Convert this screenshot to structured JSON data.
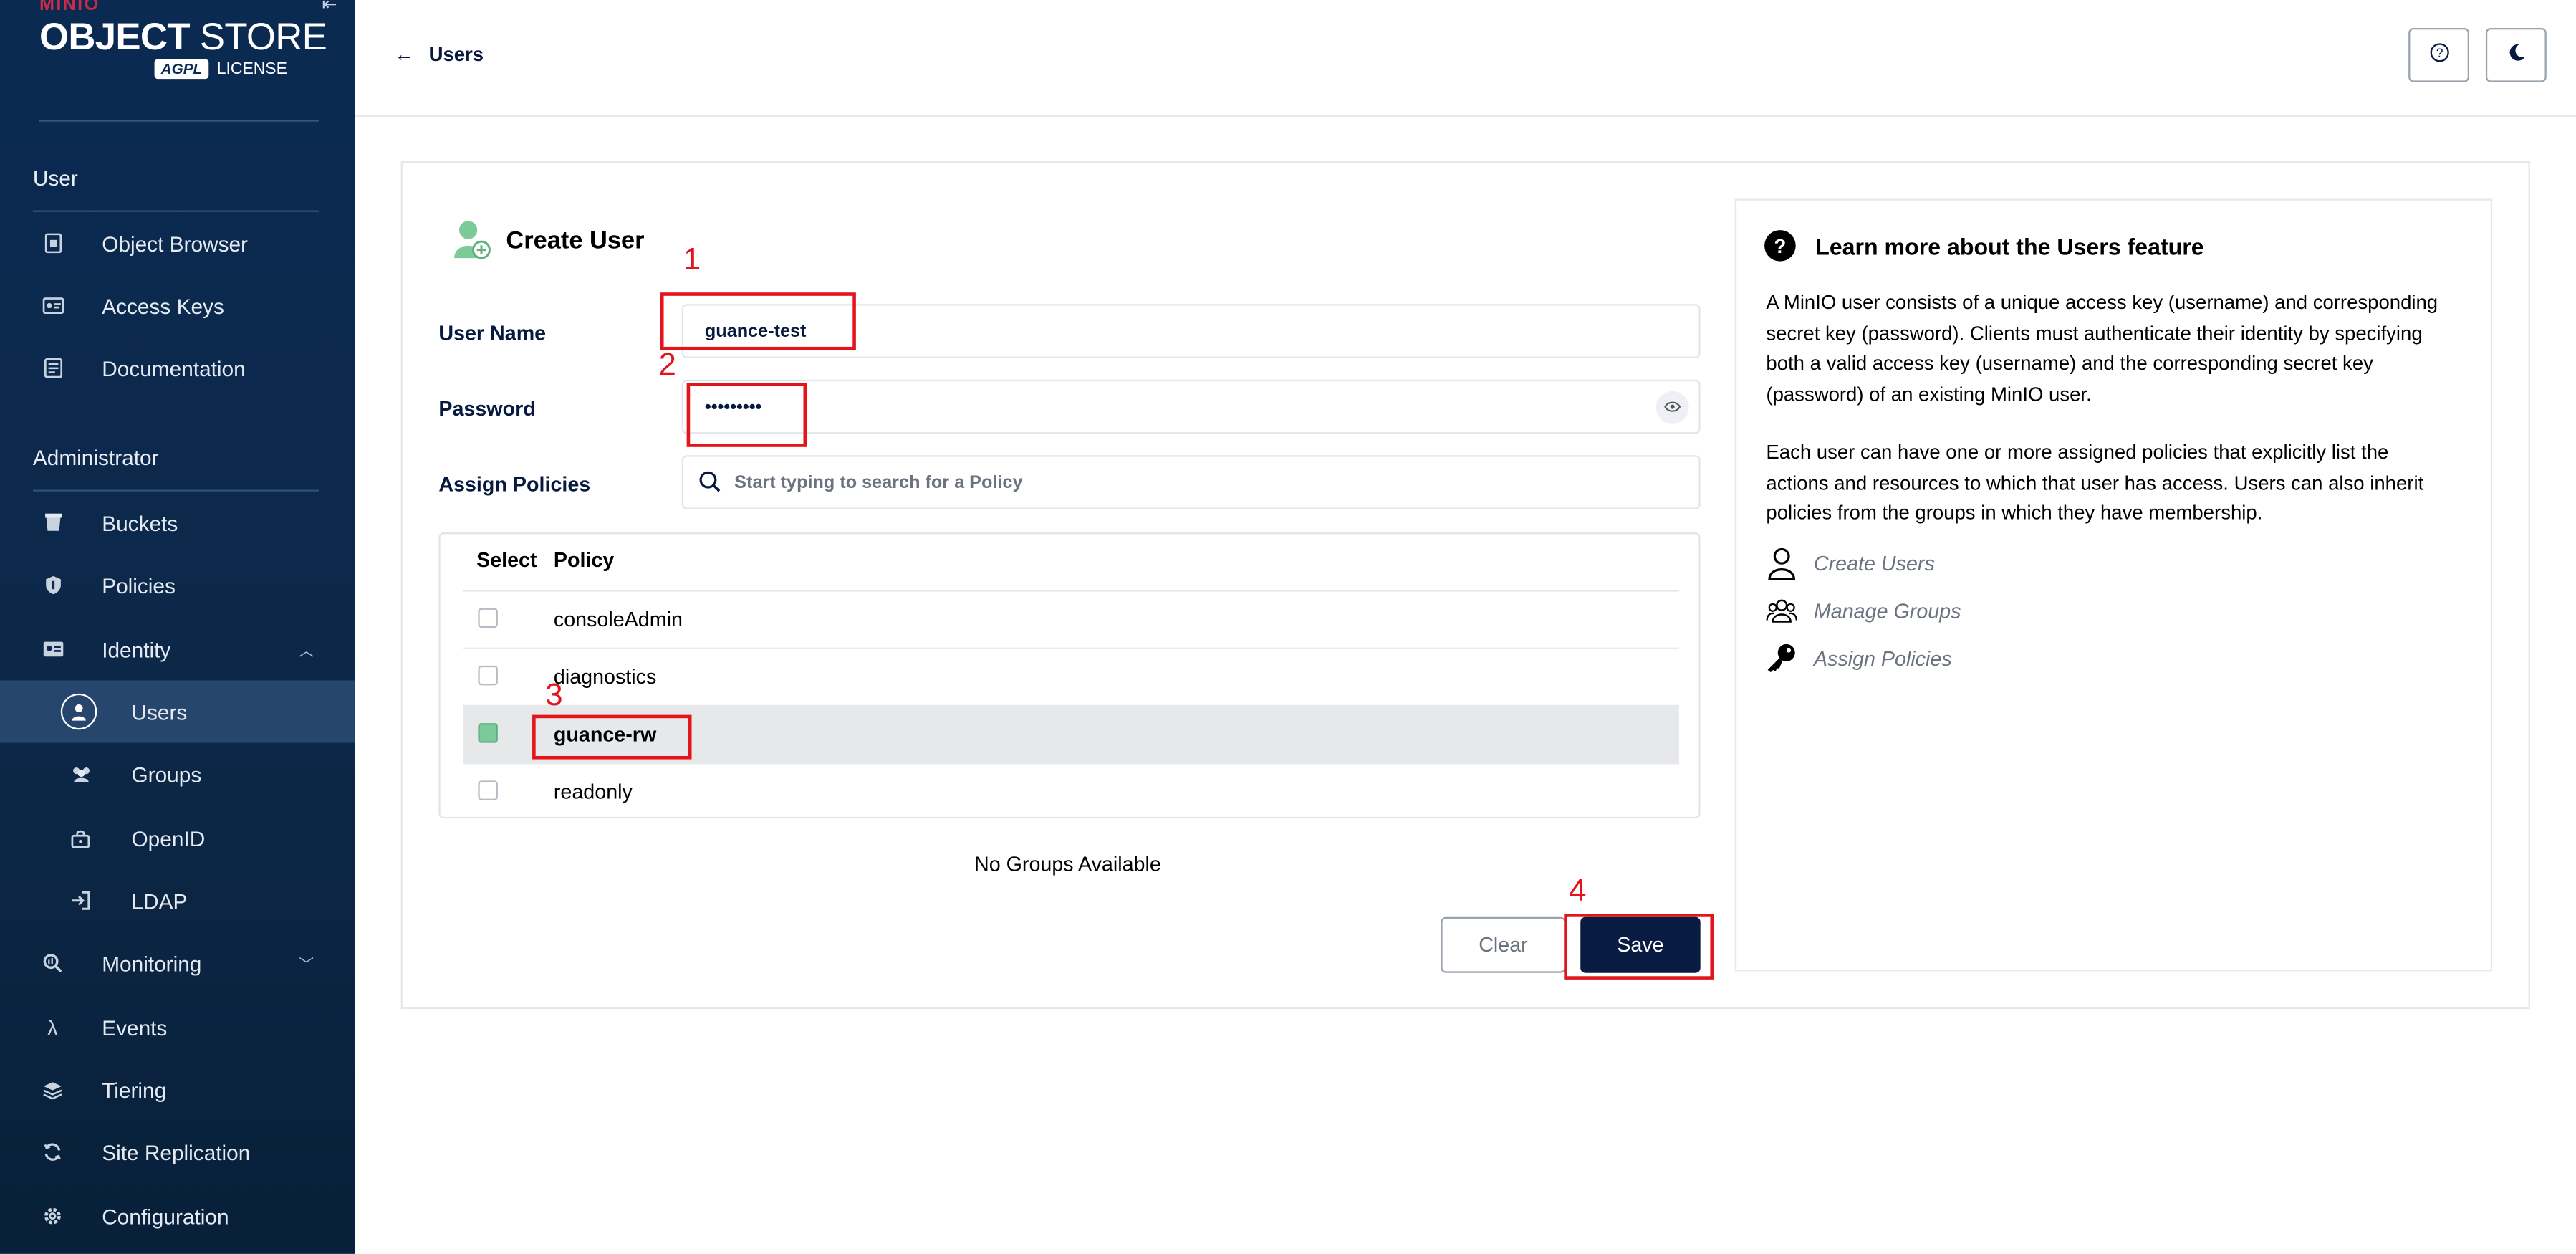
{
  "brand": {
    "top": "MINIO",
    "object": "OBJECT",
    "store": "STORE",
    "license_badge": "AGPL",
    "license": "LICENSE"
  },
  "sidebar": {
    "sections": [
      {
        "label": "User"
      },
      {
        "label": "Administrator"
      }
    ],
    "items": [
      {
        "label": "Object Browser",
        "icon": "object-browser-icon"
      },
      {
        "label": "Access Keys",
        "icon": "access-keys-icon"
      },
      {
        "label": "Documentation",
        "icon": "documentation-icon"
      },
      {
        "label": "Buckets",
        "icon": "buckets-icon"
      },
      {
        "label": "Policies",
        "icon": "policies-icon"
      },
      {
        "label": "Identity",
        "icon": "identity-icon"
      },
      {
        "label": "Users",
        "icon": "users-icon"
      },
      {
        "label": "Groups",
        "icon": "groups-icon"
      },
      {
        "label": "OpenID",
        "icon": "openid-icon"
      },
      {
        "label": "LDAP",
        "icon": "ldap-icon"
      },
      {
        "label": "Monitoring",
        "icon": "monitoring-icon"
      },
      {
        "label": "Events",
        "icon": "events-icon"
      },
      {
        "label": "Tiering",
        "icon": "tiering-icon"
      },
      {
        "label": "Site Replication",
        "icon": "site-replication-icon"
      },
      {
        "label": "Configuration",
        "icon": "configuration-icon"
      }
    ],
    "active_item": "Users"
  },
  "topbar": {
    "back_label": "Users"
  },
  "form": {
    "title": "Create User",
    "username_label": "User Name",
    "username_value": "guance-test",
    "password_label": "Password",
    "password_value": "•••••••••",
    "policies_label": "Assign Policies",
    "search_placeholder": "Start typing to search for a Policy",
    "table": {
      "col_select": "Select",
      "col_policy": "Policy",
      "rows": [
        {
          "policy": "consoleAdmin",
          "checked": false
        },
        {
          "policy": "diagnostics",
          "checked": false
        },
        {
          "policy": "guance-rw",
          "checked": true
        },
        {
          "policy": "readonly",
          "checked": false
        }
      ]
    },
    "groups_text": "No Groups Available",
    "clear_label": "Clear",
    "save_label": "Save"
  },
  "help": {
    "title": "Learn more about the Users feature",
    "p1": "A MinIO user consists of a unique access key (username) and corresponding secret key (password). Clients must authenticate their identity by specifying both a valid access key (username) and the corresponding secret key (password) of an existing MinIO user.",
    "p2": "Each user can have one or more assigned policies that explicitly list the actions and resources to which that user has access. Users can also inherit policies from the groups in which they have membership.",
    "links": [
      {
        "label": "Create Users",
        "icon": "user-icon"
      },
      {
        "label": "Manage Groups",
        "icon": "users-group-icon"
      },
      {
        "label": "Assign Policies",
        "icon": "key-icon"
      }
    ]
  },
  "annotations": [
    "1",
    "2",
    "3",
    "4"
  ],
  "colors": {
    "sidebar_bg": "#0b2a52",
    "accent": "#081c42",
    "annotation": "#e3151b",
    "checked": "#7cc99a"
  }
}
